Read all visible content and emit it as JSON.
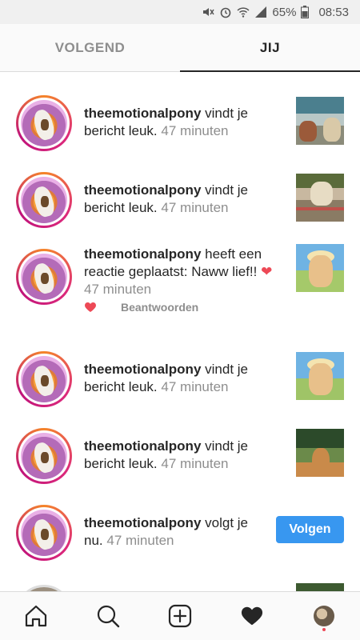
{
  "status_bar": {
    "battery": "65%",
    "time": "08:53"
  },
  "tabs": [
    {
      "label": "VOLGEND",
      "active": false
    },
    {
      "label": "JIJ",
      "active": true
    }
  ],
  "activities": [
    {
      "user": "theemotionalpony",
      "action": " vindt je bericht leuk.",
      "time": " 47 minuten"
    },
    {
      "user": "theemotionalpony",
      "action": " vindt je bericht leuk.",
      "time": " 47 minuten"
    },
    {
      "user": "theemotionalpony",
      "action": " heeft een reactie geplaatst: Naww lief!! ",
      "time": "47 minuten",
      "reply_label": "Beantwoorden"
    },
    {
      "user": "theemotionalpony",
      "action": " vindt je bericht leuk.",
      "time": " 47 minuten"
    },
    {
      "user": "theemotionalpony",
      "action": " vindt je bericht leuk.",
      "time": " 47 minuten"
    },
    {
      "user": "theemotionalpony",
      "action": " volgt je nu.",
      "time": " 47 minuten",
      "button_label": "Volgen"
    }
  ],
  "colors": {
    "accent": "#3897f0",
    "heart": "#ed4956",
    "muted": "#8e8e8e"
  },
  "bottom_nav": [
    "home-icon",
    "search-icon",
    "new-post-icon",
    "activity-heart-icon",
    "profile-avatar"
  ]
}
